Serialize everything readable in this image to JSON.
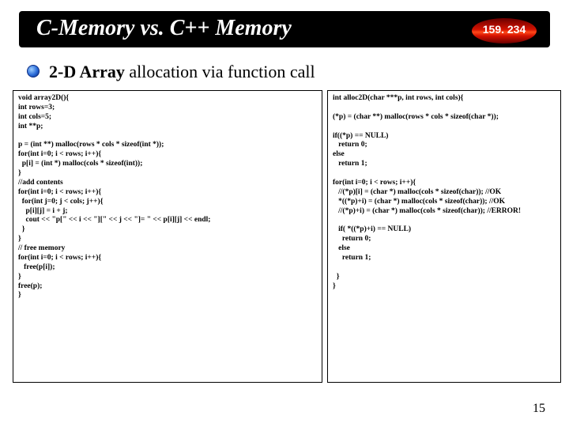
{
  "title": "C-Memory vs. C++ Memory",
  "badge": "159. 234",
  "subhead_bold": "2-D Array ",
  "subhead_rest": "allocation via function call",
  "page": "15",
  "code_left": "void array2D(){\nint rows=3;\nint cols=5;\nint **p;\n\np = (int **) malloc(rows * cols * sizeof(int *));\nfor(int i=0; i < rows; i++){\n  p[i] = (int *) malloc(cols * sizeof(int));\n}\n//add contents\nfor(int i=0; i < rows; i++){\n  for(int j=0; j < cols; j++){\n    p[i][j] = i + j;\n    cout << \"p[\" << i << \"][\" << j << \"]= \" << p[i][j] << endl;\n  }\n}\n// free memory\nfor(int i=0; i < rows; i++){\n   free(p[i]);\n}\nfree(p);\n}",
  "code_right": "int alloc2D(char ***p, int rows, int cols){\n\n(*p) = (char **) malloc(rows * cols * sizeof(char *));\n\nif((*p) == NULL)\n   return 0;\nelse\n   return 1;\n\nfor(int i=0; i < rows; i++){\n   //(*p)[i] = (char *) malloc(cols * sizeof(char)); //OK\n   *((*p)+i) = (char *) malloc(cols * sizeof(char)); //OK\n   //(*p)+i) = (char *) malloc(cols * sizeof(char)); //ERROR!\n\n   if( *((*p)+i) == NULL)\n     return 0;\n   else\n     return 1;\n\n  }\n}"
}
